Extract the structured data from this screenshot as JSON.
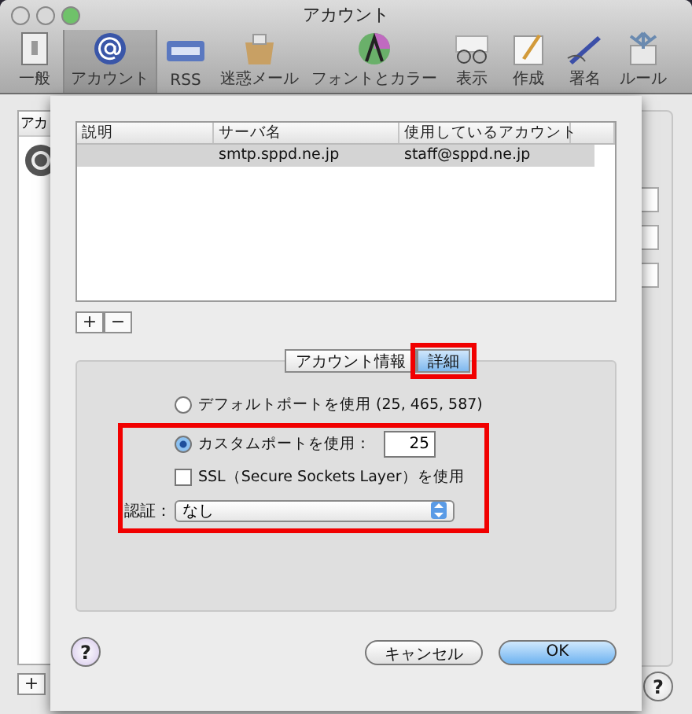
{
  "window": {
    "title": "アカウント"
  },
  "toolbar": [
    {
      "label": "一般",
      "selected": false
    },
    {
      "label": "アカウント",
      "selected": true
    },
    {
      "label": "RSS",
      "selected": false
    },
    {
      "label": "迷惑メール",
      "selected": false
    },
    {
      "label": "フォントとカラー",
      "selected": false
    },
    {
      "label": "表示",
      "selected": false
    },
    {
      "label": "作成",
      "selected": false
    },
    {
      "label": "署名",
      "selected": false
    },
    {
      "label": "ルール",
      "selected": false
    }
  ],
  "accounts_list": {
    "header": "アカ",
    "add": "+",
    "help": "?"
  },
  "sheet": {
    "table": {
      "columns": [
        "説明",
        "サーバ名",
        "使用しているアカウント"
      ],
      "rows": [
        {
          "server": "smtp.sppd.ne.jp",
          "account": "staff@sppd.ne.jp",
          "selected": true
        }
      ]
    },
    "list_buttons": [
      "+",
      "−"
    ],
    "tabs": [
      {
        "label": "アカウント情報",
        "selected": false,
        "highlighted": false
      },
      {
        "label": "詳細",
        "selected": true,
        "highlighted": true
      }
    ],
    "ports": [
      {
        "label": "デフォルトポートを使用 (25, 465, 587)",
        "selected": false,
        "highlighted": false
      },
      {
        "label": "カスタムポートを使用：",
        "selected": true,
        "highlighted": true
      }
    ],
    "port_value": "25",
    "ssl": {
      "label": "SSL（Secure Sockets Layer）を使用",
      "checked": false
    },
    "auth": {
      "label": "認証：",
      "value": "なし"
    },
    "help": "?",
    "buttons": [
      {
        "label": "キャンセル",
        "kind": "cancel"
      },
      {
        "label": "OK",
        "kind": "default"
      }
    ]
  }
}
